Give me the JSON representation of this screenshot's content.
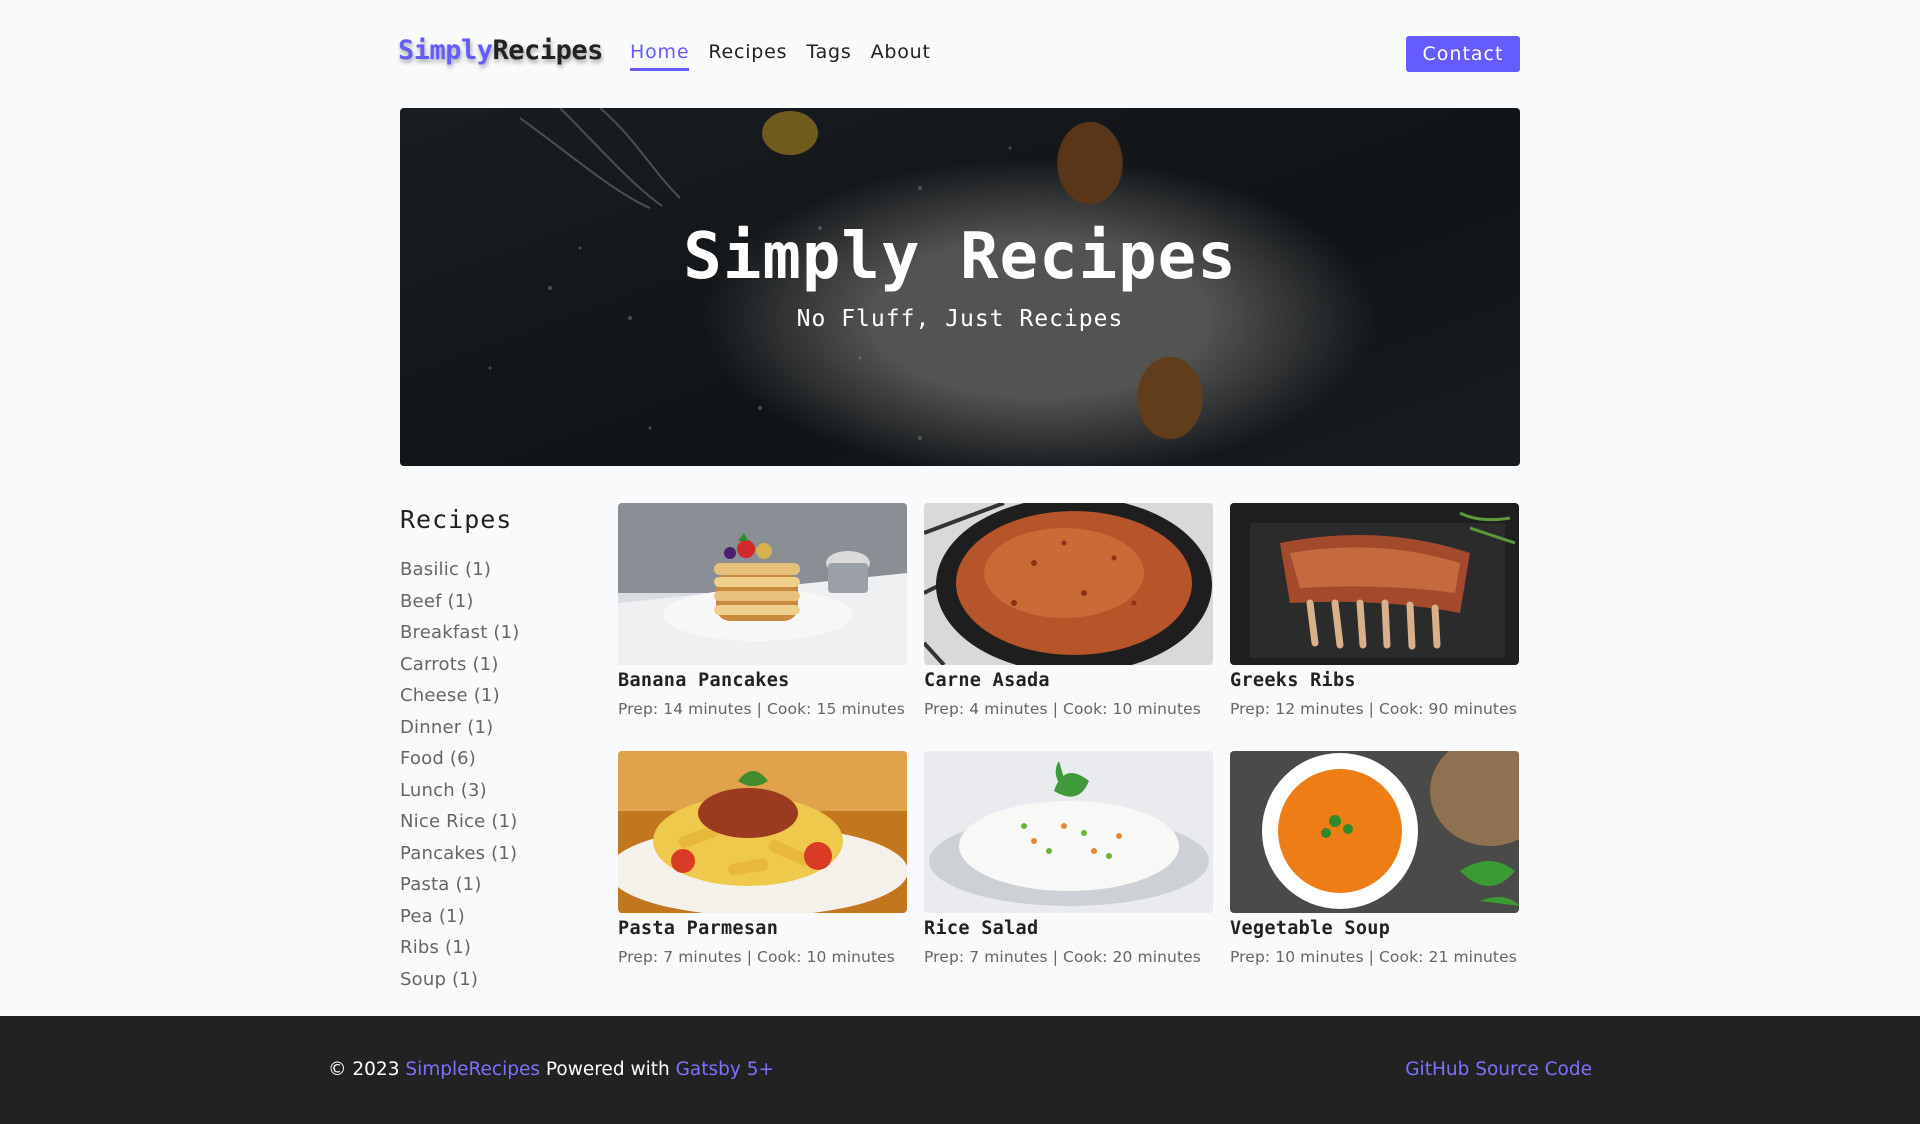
{
  "nav": {
    "logo_part1": "Simply",
    "logo_part2": "Recipes",
    "links": [
      "Home",
      "Recipes",
      "Tags",
      "About"
    ],
    "active": "Home",
    "contact": "Contact"
  },
  "hero": {
    "title": "Simply Recipes",
    "subtitle": "No Fluff, Just Recipes"
  },
  "sidebar": {
    "heading": "Recipes",
    "tags": [
      "Basilic (1)",
      "Beef (1)",
      "Breakfast (1)",
      "Carrots (1)",
      "Cheese (1)",
      "Dinner (1)",
      "Food (6)",
      "Lunch (3)",
      "Nice Rice (1)",
      "Pancakes (1)",
      "Pasta (1)",
      "Pea (1)",
      "Ribs (1)",
      "Soup (1)"
    ]
  },
  "recipes": [
    {
      "name": "Banana Pancakes",
      "meta": "Prep: 14 minutes | Cook: 15 minutes"
    },
    {
      "name": "Carne Asada",
      "meta": "Prep: 4 minutes | Cook: 10 minutes"
    },
    {
      "name": "Greeks Ribs",
      "meta": "Prep: 12 minutes | Cook: 90 minutes"
    },
    {
      "name": "Pasta Parmesan",
      "meta": "Prep: 7 minutes | Cook: 10 minutes"
    },
    {
      "name": "Rice Salad",
      "meta": "Prep: 7 minutes | Cook: 20 minutes"
    },
    {
      "name": "Vegetable Soup",
      "meta": "Prep: 10 minutes | Cook: 21 minutes"
    }
  ],
  "footer": {
    "copyright": "© 2023",
    "brand": "SimpleRecipes",
    "powered": "Powered with",
    "framework": "Gatsby 5+",
    "github": "GitHub Source Code"
  },
  "colors": {
    "accent": "#645cff",
    "footer_bg": "#222222",
    "page_bg": "#f8fafc"
  }
}
